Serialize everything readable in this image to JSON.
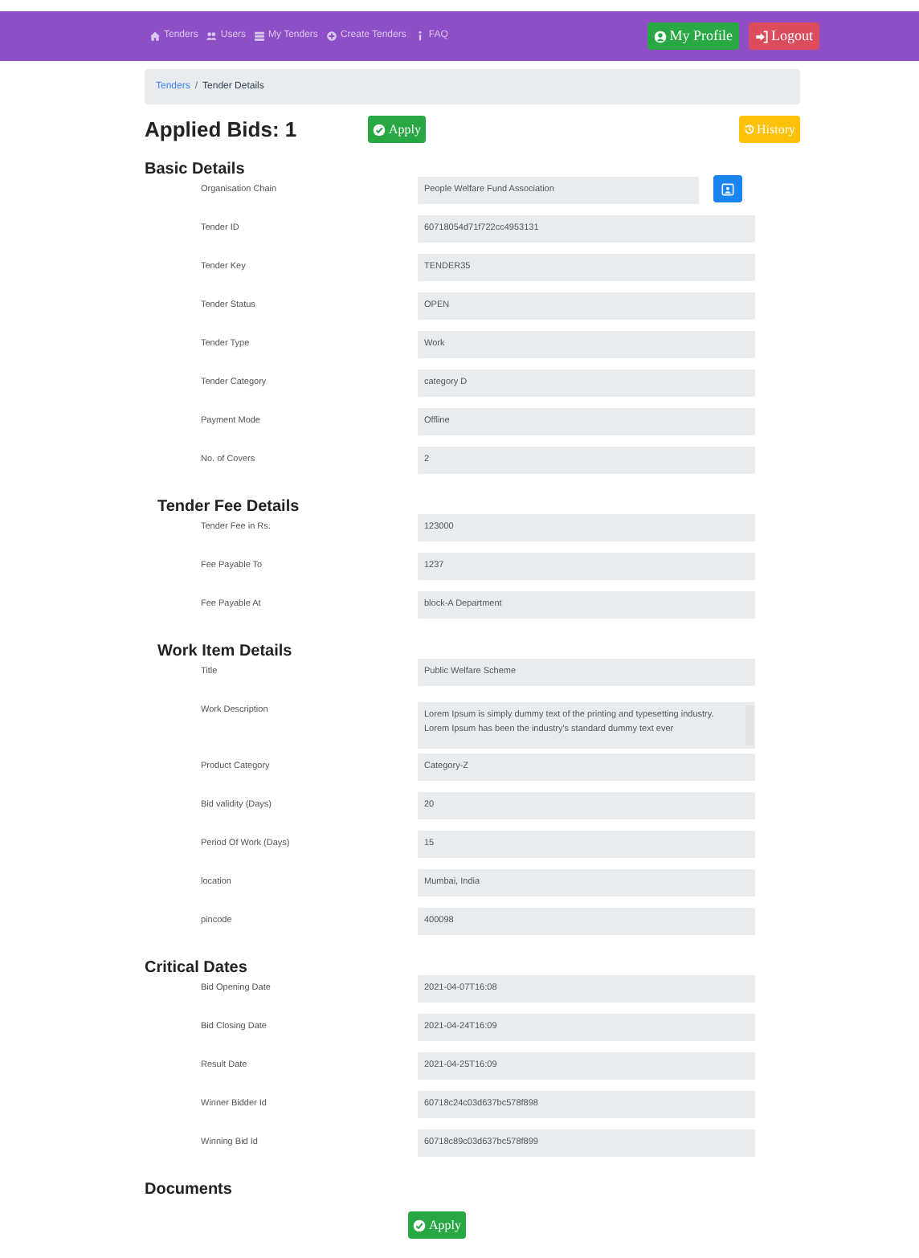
{
  "navbar": {
    "links": [
      {
        "label": "Tenders",
        "kind": "home"
      },
      {
        "label": "Users",
        "kind": "users"
      },
      {
        "label": "My Tenders",
        "kind": "list"
      },
      {
        "label": "Create Tenders",
        "kind": "plus"
      },
      {
        "label": "FAQ",
        "kind": "info"
      }
    ],
    "buttons": [
      {
        "label": "My Profile",
        "kind": "profile"
      },
      {
        "label": "Logout",
        "kind": "logout"
      }
    ]
  },
  "breadcrumb": {
    "separator": "/",
    "items": [
      {
        "label": "Tenders",
        "link": true
      },
      {
        "label": "Tender Details",
        "link": false
      }
    ]
  },
  "header": {
    "title": "Applied Bids: 1",
    "apply_button": "Apply",
    "history_button": "History"
  },
  "sections": [
    {
      "title": "Basic Details",
      "fields": [
        {
          "label": "Organisation Chain",
          "value": "People Welfare Fund Association",
          "kind": "picker"
        },
        {
          "label": "Tender ID",
          "value": "60718054d71f722cc4953131",
          "kind": "input"
        },
        {
          "label": "Tender Key",
          "value": "TENDER35",
          "kind": "input"
        },
        {
          "label": "Tender Status",
          "value": "OPEN",
          "kind": "input"
        },
        {
          "label": "Tender Type",
          "value": "Work",
          "kind": "input"
        },
        {
          "label": "Tender Category",
          "value": "category D",
          "kind": "input"
        },
        {
          "label": "Payment Mode",
          "value": "Offline",
          "kind": "input"
        },
        {
          "label": "No. of Covers",
          "value": "2",
          "kind": "input"
        }
      ]
    },
    {
      "title": "Tender Fee Details",
      "fields": [
        {
          "label": "Tender Fee in Rs.",
          "value": "123000",
          "kind": "input"
        },
        {
          "label": "Fee Payable To",
          "value": "1237",
          "kind": "input"
        },
        {
          "label": "Fee Payable At",
          "value": "block-A Department",
          "kind": "input"
        }
      ]
    },
    {
      "title": "Work Item Details",
      "fields": [
        {
          "label": "Title",
          "value": "Public Welfare Scheme",
          "kind": "input"
        },
        {
          "label": "Work Description",
          "value": "Lorem Ipsum is simply dummy text of the printing and typesetting industry. Lorem Ipsum has been the industry's standard dummy text ever",
          "kind": "textarea"
        },
        {
          "label": "Product Category",
          "value": "Category-Z",
          "kind": "input"
        },
        {
          "label": "Bid validity (Days)",
          "value": "20",
          "kind": "input"
        },
        {
          "label": "Period Of Work (Days)",
          "value": "15",
          "kind": "input"
        },
        {
          "label": "location",
          "value": "Mumbai, India",
          "kind": "input"
        },
        {
          "label": "pincode",
          "value": "400098",
          "kind": "input"
        }
      ]
    },
    {
      "title": "Critical Dates",
      "fields": [
        {
          "label": "Bid Opening Date",
          "value": "2021-04-07T16:08",
          "kind": "input"
        },
        {
          "label": "Bid Closing Date",
          "value": "2021-04-24T16:09",
          "kind": "input"
        },
        {
          "label": "Result Date",
          "value": "2021-04-25T16:09",
          "kind": "input"
        },
        {
          "label": "Winner Bidder Id",
          "value": "60718c24c03d637bc578f898",
          "kind": "input"
        },
        {
          "label": "Winning Bid Id",
          "value": "60718c89c03d637bc578f899",
          "kind": "input"
        }
      ]
    },
    {
      "title": "Documents"
    }
  ],
  "footer_button": "Apply"
}
